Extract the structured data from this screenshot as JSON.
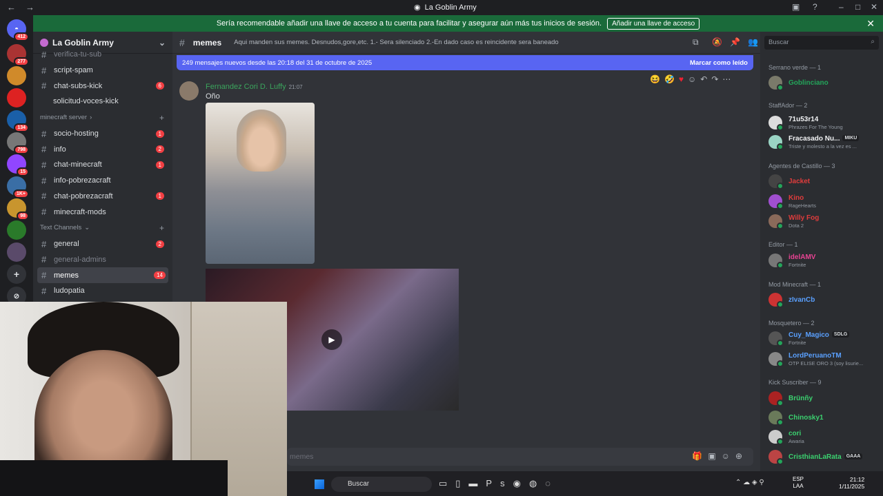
{
  "window": {
    "title": "La Goblin Army"
  },
  "notice": {
    "text": "Sería recomendable añadir una llave de acceso a tu cuenta para facilitar y asegurar aún más tus inicios de sesión.",
    "button": "Añadir una llave de acceso"
  },
  "servers": [
    {
      "badge": "412"
    },
    {
      "badge": "277"
    },
    {
      "badge": ""
    },
    {
      "badge": ""
    },
    {
      "badge": "134"
    },
    {
      "badge": "798"
    },
    {
      "badge": "15"
    },
    {
      "badge": "1K+"
    },
    {
      "badge": "98"
    },
    {
      "badge": ""
    },
    {
      "badge": ""
    }
  ],
  "sidebar": {
    "guild_name": "La Goblin Army",
    "channels_top": [
      {
        "name": "verifica-tu-sub",
        "badge": ""
      },
      {
        "name": "script-spam",
        "badge": ""
      },
      {
        "name": "chat-subs-kick",
        "badge": "6"
      },
      {
        "name": "solicitud-voces-kick",
        "badge": ""
      }
    ],
    "cat_minecraft": "minecraft server",
    "channels_minecraft": [
      {
        "name": "socio-hosting",
        "badge": "1"
      },
      {
        "name": "info",
        "badge": "2"
      },
      {
        "name": "chat-minecraft",
        "badge": "1"
      },
      {
        "name": "info-pobrezacraft",
        "badge": ""
      },
      {
        "name": "chat-pobrezacraft",
        "badge": "1"
      },
      {
        "name": "minecraft-mods",
        "badge": ""
      }
    ],
    "cat_text": "Text Channels",
    "channels_text": [
      {
        "name": "general",
        "badge": "2"
      },
      {
        "name": "general-admins",
        "badge": ""
      },
      {
        "name": "memes",
        "badge": "14"
      },
      {
        "name": "ludopatia",
        "badge": ""
      }
    ]
  },
  "chat": {
    "channel": "memes",
    "topic": "Aqui manden sus memes. Desnudos,gore,etc. 1.- Sera silenciado 2.-En dado caso es reincidente sera baneado",
    "new_messages": "249 mensajes nuevos desde las 20:18 del 31 de octubre de 2025",
    "mark_read": "Marcar como leído",
    "message": {
      "author": "Fernandez Cori D. Luffy",
      "time": "21:07",
      "text": "Oño"
    },
    "input_placeholder": "memes"
  },
  "members": {
    "search_placeholder": "Buscar",
    "groups": [
      {
        "title": "Serrano verde — 1",
        "members": [
          {
            "name": "Goblinciano",
            "status": "",
            "color": "#23a55a"
          }
        ]
      },
      {
        "title": "StaffAdor — 2",
        "members": [
          {
            "name": "71u53r14",
            "status": "Phrazes For The Young",
            "color": "#f2f3f5"
          },
          {
            "name": "Fracasado Nu...",
            "status": "Triste y molesto a la vez es ...",
            "color": "#f2f3f5",
            "tag": "MIKU"
          }
        ]
      },
      {
        "title": "Agentes de Castillo — 3",
        "members": [
          {
            "name": "Jacket",
            "status": "",
            "color": "#e03c3c"
          },
          {
            "name": "Kino",
            "status": "RageHearts",
            "color": "#e03c3c"
          },
          {
            "name": "Willy Fog",
            "status": "Dota 2",
            "color": "#e03c3c"
          }
        ]
      },
      {
        "title": "Editor — 1",
        "members": [
          {
            "name": "idelAMV",
            "status": "Fortnite",
            "color": "#e84393"
          }
        ]
      },
      {
        "title": "Mod Minecraft — 1",
        "members": [
          {
            "name": "zIvanCb",
            "status": "",
            "color": "#5aa0ff"
          }
        ]
      },
      {
        "title": "Mosquetero — 2",
        "members": [
          {
            "name": "Cuy_Magico",
            "status": "Fortnite",
            "color": "#5aa0ff",
            "tag": "SDLG"
          },
          {
            "name": "LordPeruanoTM",
            "status": "OTP ELISE ORO 3 (soy lisurie...",
            "color": "#5aa0ff"
          }
        ]
      },
      {
        "title": "Kick Suscriber — 9",
        "members": [
          {
            "name": "Brünñy",
            "status": "",
            "color": "#3bd16f"
          },
          {
            "name": "Chinosky1",
            "status": "",
            "color": "#3bd16f"
          },
          {
            "name": "cori",
            "status": "Awaria",
            "color": "#3bd16f"
          },
          {
            "name": "CristhianLaRata",
            "status": "",
            "color": "#3bd16f",
            "tag": "GAAA"
          }
        ]
      }
    ]
  },
  "taskbar": {
    "search": "Buscar",
    "lang1": "ESP",
    "lang2": "LAA",
    "time": "21:12",
    "date": "1/11/2025"
  }
}
